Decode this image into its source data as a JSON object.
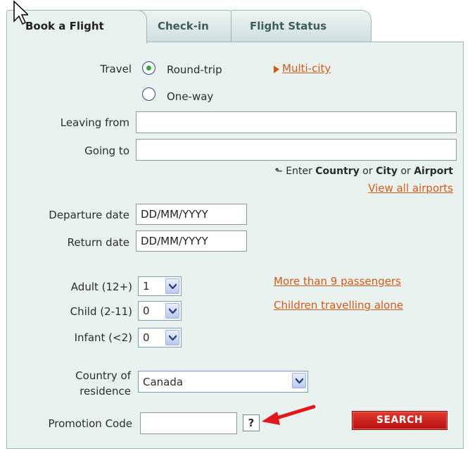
{
  "tabs": [
    {
      "label": "Book a Flight",
      "active": true
    },
    {
      "label": "Check-in",
      "active": false
    },
    {
      "label": "Flight Status",
      "active": false
    }
  ],
  "travel": {
    "label": "Travel",
    "options": [
      {
        "label": "Round-trip",
        "selected": true
      },
      {
        "label": "One-way",
        "selected": false
      }
    ],
    "multi_city_link": "Multi-city"
  },
  "leaving_from": {
    "label": "Leaving from",
    "value": ""
  },
  "going_to": {
    "label": "Going to",
    "value": ""
  },
  "hint": {
    "prefix": "Enter",
    "country": "Country",
    "or1": "or",
    "city": "City",
    "or2": "or",
    "airport": "Airport"
  },
  "view_all_airports_link": "View all airports",
  "departure_date": {
    "label": "Departure date",
    "value": "DD/MM/YYYY"
  },
  "return_date": {
    "label": "Return date",
    "value": "DD/MM/YYYY"
  },
  "passengers": {
    "adult": {
      "label": "Adult (12+)",
      "value": "1"
    },
    "child": {
      "label": "Child (2-11)",
      "value": "0"
    },
    "infant": {
      "label": "Infant (<2)",
      "value": "0"
    }
  },
  "more_passengers_link": "More than 9 passengers",
  "children_alone_link": "Children travelling alone",
  "country_of_residence": {
    "label_line1": "Country of",
    "label_line2": "residence",
    "value": "Canada"
  },
  "promotion_code": {
    "label": "Promotion Code",
    "value": "",
    "help_label": "?"
  },
  "search_button": "SEARCH",
  "colors": {
    "accent_link": "#d35a1d",
    "panel_bg": "#e9f2ef",
    "search_button": "#c8161a",
    "annotation_arrow": "#e3171b"
  }
}
